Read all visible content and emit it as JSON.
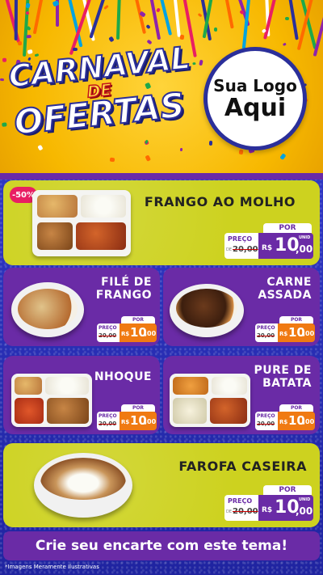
{
  "header": {
    "title_line1": "CARNAVAL",
    "title_line2": "DE",
    "title_line3": "OFERTAS",
    "logo_line1": "Sua Logo",
    "logo_line2": "Aqui"
  },
  "colors": {
    "header_yellow": "#f7b800",
    "card_yellow": "#cdd21f",
    "card_purple": "#6a2ba6",
    "price_orange": "#f07a12",
    "badge_pink": "#e91e63",
    "background_blue": "#2a2ea8"
  },
  "badge": "-50%",
  "price_labels": {
    "por": "POR",
    "preco": "PREÇO",
    "de": "DE",
    "currency": "R$",
    "unit": "UNID"
  },
  "items": [
    {
      "name": "FRANGO AO MOLHO",
      "old_price": "20,00",
      "price_int": "10",
      "price_cents": ",00"
    },
    {
      "name_line1": "FILÉ DE",
      "name_line2": "FRANGO",
      "old_price": "20,00",
      "price_int": "10",
      "price_cents": ",00"
    },
    {
      "name_line1": "CARNE",
      "name_line2": "ASSADA",
      "old_price": "20,00",
      "price_int": "10",
      "price_cents": ",00"
    },
    {
      "name": "NHOQUE",
      "old_price": "20,00",
      "price_int": "10",
      "price_cents": ",00"
    },
    {
      "name_line1": "PURE DE",
      "name_line2": "BATATA",
      "old_price": "20,00",
      "price_int": "10",
      "price_cents": ",00"
    },
    {
      "name": "FAROFA CASEIRA",
      "old_price": "20,00",
      "price_int": "10",
      "price_cents": ",00"
    }
  ],
  "cta": "Crie seu encarte com este tema!",
  "disclaimer": "*Imagens Meramente Ilustrativas"
}
